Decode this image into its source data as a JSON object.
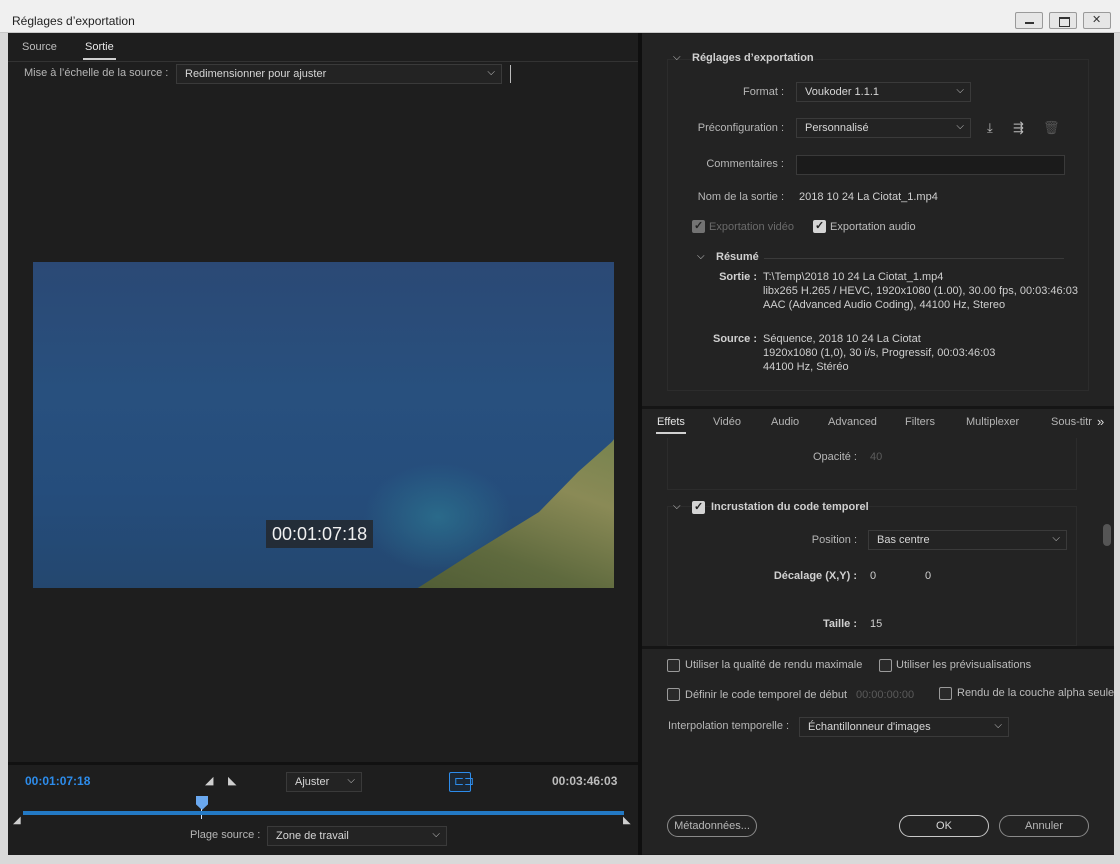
{
  "window": {
    "title": "Réglages d’exportation"
  },
  "left": {
    "tabs": [
      "Source",
      "Sortie"
    ],
    "active_tab": "Sortie",
    "scale_label": "Mise à l’échelle de la source :",
    "scale_value": "Redimensionner pour ajuster",
    "timecode_overlay": "00:01:07:18",
    "current_time": "00:01:07:18",
    "end_time": "00:03:46:03",
    "zoom_value": "Ajuster",
    "playhead_fraction": 0.3,
    "range_label": "Plage source :",
    "range_value": "Zone de travail"
  },
  "right": {
    "section_title": "Réglages d’exportation",
    "format_label": "Format :",
    "format_value": "Voukoder 1.1.1",
    "preset_label": "Préconfiguration :",
    "preset_value": "Personnalisé",
    "comments_label": "Commentaires :",
    "comments_value": "",
    "output_name_label": "Nom de la sortie :",
    "output_name_value": "2018 10 24 La Ciotat_1.mp4",
    "export_video_label": "Exportation vidéo",
    "export_audio_label": "Exportation audio",
    "summary_title": "Résumé",
    "summary_output_label": "Sortie :",
    "summary_output_lines": [
      "T:\\Temp\\2018 10 24 La Ciotat_1.mp4",
      "libx265 H.265 / HEVC, 1920x1080 (1.00), 30.00 fps, 00:03:46:03",
      "AAC (Advanced Audio Coding), 44100 Hz, Stereo"
    ],
    "summary_source_label": "Source :",
    "summary_source_lines": [
      "Séquence, 2018 10 24 La Ciotat",
      "1920x1080 (1,0), 30 i/s, Progressif, 00:03:46:03",
      "44100 Hz, Stéréo"
    ],
    "tabs": [
      "Effets",
      "Vidéo",
      "Audio",
      "Advanced",
      "Filters",
      "Multiplexer",
      "Sous-titr"
    ],
    "active_tab": "Effets",
    "opacity_label": "Opacité :",
    "opacity_value": "40",
    "timecode_section_title": "Incrustation du code temporel",
    "position_label": "Position :",
    "position_value": "Bas centre",
    "offset_label": "Décalage (X,Y) :",
    "offset_x": "0",
    "offset_y": "0",
    "size_label": "Taille :",
    "size_value": "15",
    "opt_max_quality": "Utiliser la qualité de rendu maximale",
    "opt_previews": "Utiliser les prévisualisations",
    "opt_start_tc": "Définir le code temporel de début",
    "start_tc_value": "00:00:00:00",
    "opt_alpha": "Rendu de la couche alpha seule",
    "interp_label": "Interpolation temporelle :",
    "interp_value": "Échantillonneur d'images",
    "metadata_button": "Métadonnées...",
    "ok_button": "OK",
    "cancel_button": "Annuler"
  },
  "colors": {
    "accent": "#2d8ceb",
    "scrubber": "#2379c4"
  }
}
